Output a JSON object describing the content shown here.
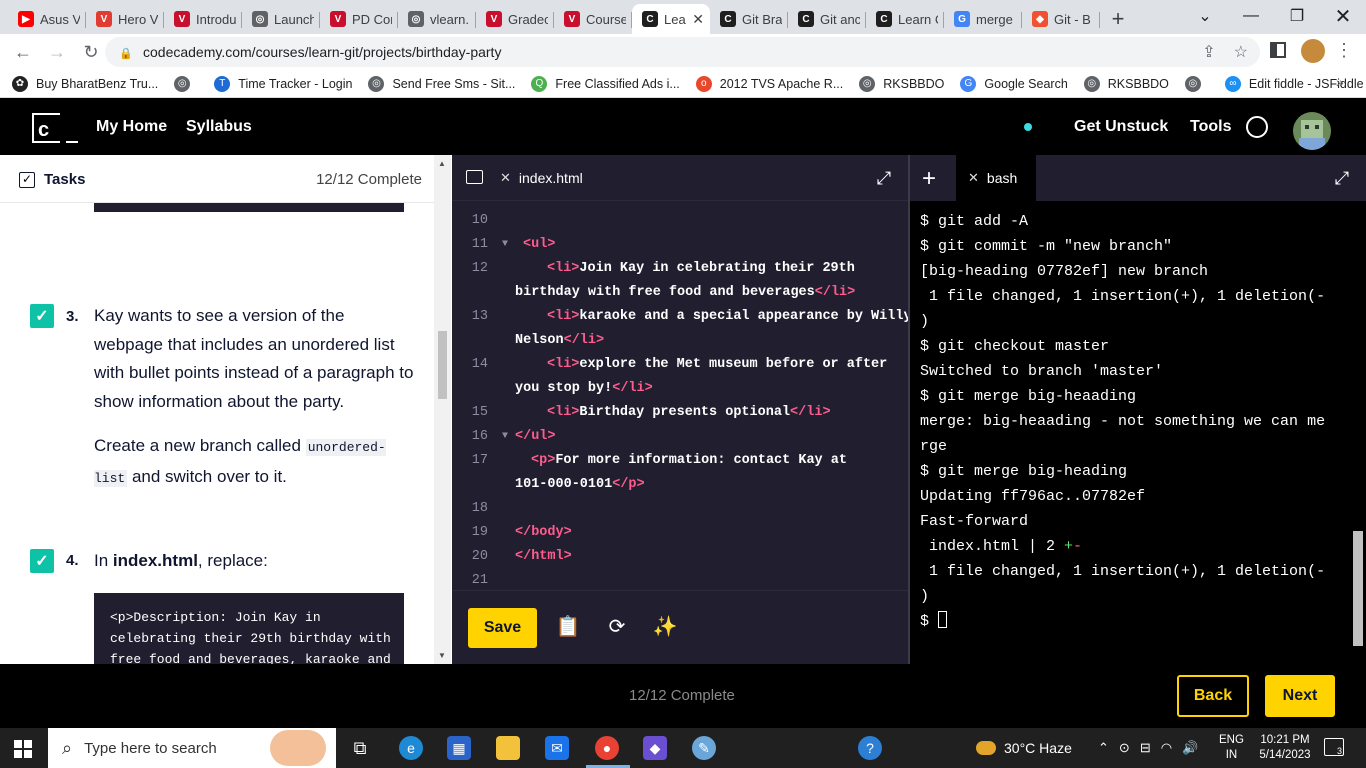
{
  "browser": {
    "tabs": [
      {
        "label": "Asus V",
        "color": "#ff0000",
        "glyph": "▶"
      },
      {
        "label": "Hero V",
        "color": "#e03c31",
        "glyph": "V"
      },
      {
        "label": "Introdu",
        "color": "#c8102e",
        "glyph": "V"
      },
      {
        "label": "Launch",
        "color": "#5f6368",
        "glyph": "◎"
      },
      {
        "label": "PD Cor",
        "color": "#c8102e",
        "glyph": "V"
      },
      {
        "label": "vlearn.",
        "color": "#5f6368",
        "glyph": "◎"
      },
      {
        "label": "Gradec",
        "color": "#c8102e",
        "glyph": "V"
      },
      {
        "label": "Course",
        "color": "#c8102e",
        "glyph": "V"
      },
      {
        "label": "Lea",
        "color": "#1f1f1f",
        "glyph": "C",
        "active": true
      },
      {
        "label": "Git Bra",
        "color": "#1f1f1f",
        "glyph": "C"
      },
      {
        "label": "Git anc",
        "color": "#1f1f1f",
        "glyph": "C"
      },
      {
        "label": "Learn C",
        "color": "#1f1f1f",
        "glyph": "C"
      },
      {
        "label": "merge",
        "color": "#4285f4",
        "glyph": "G"
      },
      {
        "label": "Git - B",
        "color": "#f05133",
        "glyph": "◆"
      }
    ],
    "url": "codecademy.com/courses/learn-git/projects/birthday-party",
    "bookmarks": [
      {
        "label": "Buy BharatBenz Tru...",
        "color": "#222",
        "glyph": "✿"
      },
      {
        "label": "",
        "color": "#5f6368",
        "glyph": "◎"
      },
      {
        "label": "Time Tracker - Login",
        "color": "#1e6bd6",
        "glyph": "T"
      },
      {
        "label": "Send Free Sms - Sit...",
        "color": "#5f6368",
        "glyph": "◎"
      },
      {
        "label": "Free Classified Ads i...",
        "color": "#4caf50",
        "glyph": "Q"
      },
      {
        "label": "2012 TVS Apache R...",
        "color": "#e8492d",
        "glyph": "o"
      },
      {
        "label": "RKSBBDO",
        "color": "#5f6368",
        "glyph": "◎"
      },
      {
        "label": "Google Search",
        "color": "#4285f4",
        "glyph": "G"
      },
      {
        "label": "RKSBBDO",
        "color": "#5f6368",
        "glyph": "◎"
      },
      {
        "label": "",
        "color": "#5f6368",
        "glyph": "◎"
      },
      {
        "label": "Edit fiddle - JSFiddle",
        "color": "#1c90f3",
        "glyph": "∞"
      }
    ]
  },
  "header": {
    "logo": "c",
    "nav": [
      "My Home",
      "Syllabus"
    ],
    "get_unstuck": "Get Unstuck",
    "tools": "Tools"
  },
  "tasks": {
    "title": "Tasks",
    "progress": "12/12 Complete",
    "task3": {
      "num": "3.",
      "text": "Kay wants to see a version of the webpage that includes an unordered list with bullet points instead of a paragraph to show information about the party.",
      "text2a": "Create a new branch called ",
      "code": "unordered-list",
      "text2b": " and switch over to it."
    },
    "task4": {
      "num": "4.",
      "pre": "In ",
      "file": "index.html",
      "post": ", replace:",
      "code": "<p>Description: Join Kay in\ncelebrating their 29th birthday with\nfree food and beverages, karaoke and"
    }
  },
  "editor": {
    "filename": "index.html",
    "lines": [
      {
        "n": "10",
        "parts": []
      },
      {
        "n": "11",
        "fold": "▼",
        "parts": [
          {
            "t": "tag",
            "v": "<ul>"
          }
        ],
        "indent": 1
      },
      {
        "n": "12",
        "parts": [
          {
            "t": "tag",
            "v": "<li>"
          },
          {
            "t": "txt",
            "v": "Join Kay in celebrating their 29th"
          }
        ],
        "indent": 3
      },
      {
        "n": "",
        "parts": [
          {
            "t": "txt",
            "v": "birthday with free food and beverages"
          },
          {
            "t": "tag",
            "v": "</li>"
          }
        ],
        "indent": 0
      },
      {
        "n": "13",
        "parts": [
          {
            "t": "tag",
            "v": "<li>"
          },
          {
            "t": "txt",
            "v": "karaoke and a special appearance by Willy"
          }
        ],
        "indent": 3
      },
      {
        "n": "",
        "parts": [
          {
            "t": "txt",
            "v": "Nelson"
          },
          {
            "t": "tag",
            "v": "</li>"
          }
        ],
        "indent": 0
      },
      {
        "n": "14",
        "parts": [
          {
            "t": "tag",
            "v": "<li>"
          },
          {
            "t": "txt",
            "v": "explore the Met museum before or after"
          }
        ],
        "indent": 3
      },
      {
        "n": "",
        "parts": [
          {
            "t": "txt",
            "v": "you stop by!"
          },
          {
            "t": "tag",
            "v": "</li>"
          }
        ],
        "indent": 0
      },
      {
        "n": "15",
        "parts": [
          {
            "t": "tag",
            "v": "<li>"
          },
          {
            "t": "txt",
            "v": "Birthday presents optional"
          },
          {
            "t": "tag",
            "v": "</li>"
          }
        ],
        "indent": 3
      },
      {
        "n": "16",
        "fold": "▼",
        "parts": [
          {
            "t": "tag",
            "v": "</ul>"
          }
        ],
        "indent": 0
      },
      {
        "n": "17",
        "parts": [
          {
            "t": "tag",
            "v": "<p>"
          },
          {
            "t": "txt",
            "v": "For more information: contact Kay at"
          }
        ],
        "indent": 2
      },
      {
        "n": "",
        "parts": [
          {
            "t": "txt",
            "v": "101-000-0101"
          },
          {
            "t": "tag",
            "v": "</p>"
          }
        ],
        "indent": 0
      },
      {
        "n": "18",
        "parts": []
      },
      {
        "n": "19",
        "parts": [
          {
            "t": "tag",
            "v": "</body>"
          }
        ],
        "indent": 0
      },
      {
        "n": "20",
        "parts": [
          {
            "t": "tag",
            "v": "</html>"
          }
        ],
        "indent": 0
      },
      {
        "n": "21",
        "parts": []
      }
    ],
    "save": "Save"
  },
  "terminal": {
    "tab": "bash",
    "lines": [
      "$ git add -A",
      "$ git commit -m \"new branch\"",
      "[big-heading 07782ef] new branch",
      " 1 file changed, 1 insertion(+), 1 deletion(-",
      ")",
      "$ git checkout master",
      "Switched to branch 'master'",
      "$ git merge big-heaading",
      "merge: big-heaading - not something we can me",
      "rge",
      "$ git merge big-heading",
      "Updating ff796ac..07782ef",
      "Fast-forward",
      " index.html | 2 {{+-}}",
      " 1 file changed, 1 insertion(+), 1 deletion(-",
      ")",
      "$ {{cursor}}"
    ]
  },
  "footer": {
    "status": "12/12 Complete",
    "back": "Back",
    "next": "Next"
  },
  "taskbar": {
    "search_placeholder": "Type here to search",
    "weather": "30°C  Haze",
    "lang1": "ENG",
    "lang2": "IN",
    "time": "10:21 PM",
    "date": "5/14/2023",
    "notifications": "3"
  }
}
